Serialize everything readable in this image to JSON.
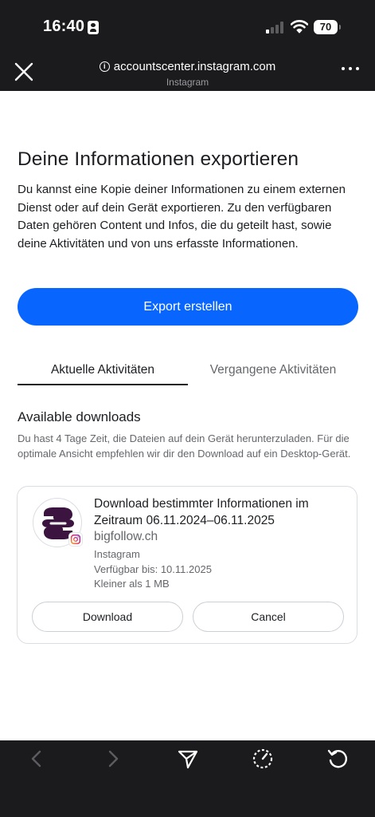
{
  "status": {
    "time": "16:40",
    "battery": "70"
  },
  "browser": {
    "url": "accountscenter.instagram.com",
    "subtitle": "Instagram"
  },
  "page": {
    "title": "Deine Informationen exportieren",
    "intro": "Du kannst eine Kopie deiner Informationen zu einem externen Dienst oder auf dein Gerät exportieren. Zu den verfügbaren Daten gehören Content und Infos, die du geteilt hast, sowie deine Aktivitäten und von uns erfasste Informationen.",
    "export_button": "Export erstellen"
  },
  "tabs": [
    {
      "label": "Aktuelle Aktivitäten",
      "active": true
    },
    {
      "label": "Vergangene Aktivitäten",
      "active": false
    }
  ],
  "downloads": {
    "title": "Available downloads",
    "note": "Du hast 4 Tage Zeit, die Dateien auf dein Gerät herunterzuladen. Für die optimale Ansicht empfehlen wir dir den Download auf ein Desktop-Gerät.",
    "card": {
      "title": "Download bestimmter Informationen im Zeitraum 06.11.2024–06.11.2025",
      "account": "bigfollow.ch",
      "platform": "Instagram",
      "available_until": "Verfügbar bis: 10.11.2025",
      "size": "Kleiner als 1 MB",
      "download_button": "Download",
      "cancel_button": "Cancel"
    }
  },
  "colors": {
    "accent": "#0866ff",
    "chrome": "#1b1b1d",
    "logo": "#3b1440"
  },
  "toolbar": [
    "back-icon",
    "forward-icon",
    "share-icon",
    "speed-icon",
    "reload-icon"
  ]
}
